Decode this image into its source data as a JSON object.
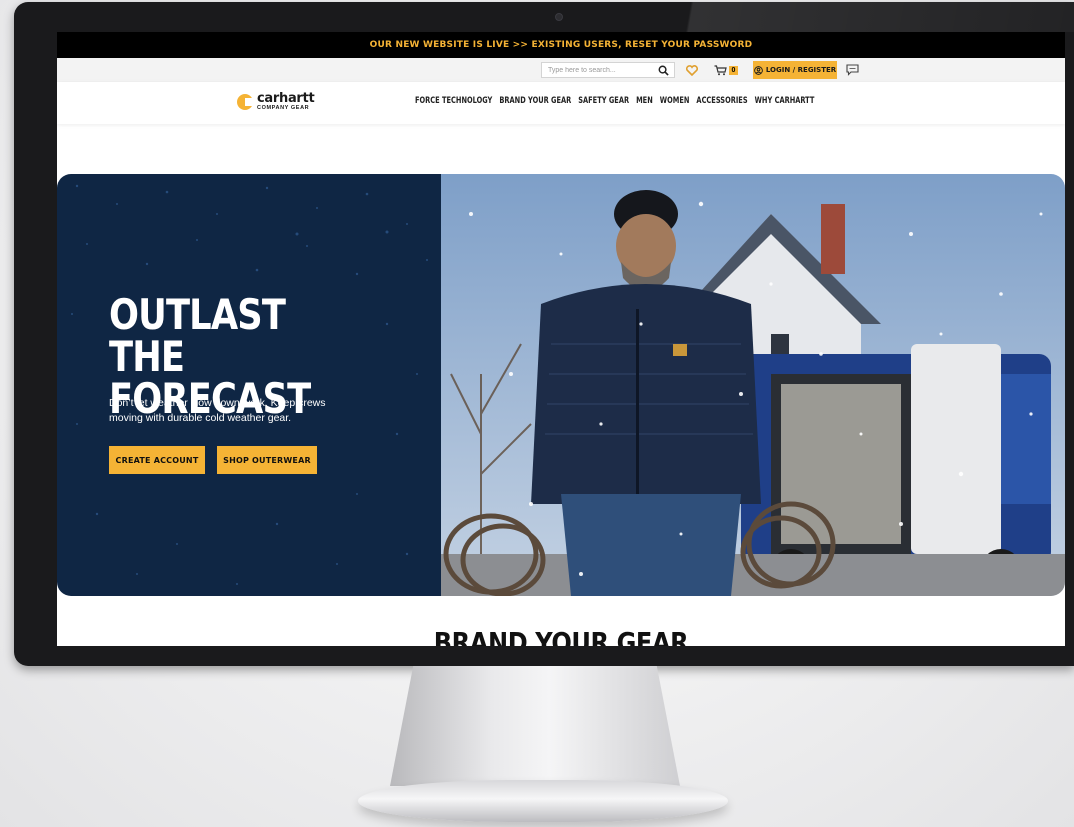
{
  "announcement": {
    "text": "OUR NEW WEBSITE IS LIVE >> EXISTING USERS, RESET YOUR PASSWORD"
  },
  "utility": {
    "search_placeholder": "Type here to search...",
    "cart_count": "0",
    "login_label": "LOGIN / REGISTER"
  },
  "logo": {
    "word": "carhartt",
    "sub": "COMPANY GEAR"
  },
  "nav": {
    "items": [
      {
        "label": "FORCE TECHNOLOGY"
      },
      {
        "label": "BRAND YOUR GEAR"
      },
      {
        "label": "SAFETY GEAR"
      },
      {
        "label": "MEN"
      },
      {
        "label": "WOMEN"
      },
      {
        "label": "ACCESSORIES"
      },
      {
        "label": "WHY CARHARTT"
      }
    ]
  },
  "hero": {
    "title_line1": "OUTLAST THE",
    "title_line2": "FORECAST",
    "subtitle": "Don’t let weather slow down work. Keep crews moving with durable cold weather gear.",
    "primary_button": "CREATE ACCOUNT",
    "secondary_button": "SHOP OUTERWEAR"
  },
  "next_section": {
    "heading": "BRAND YOUR GEAR"
  },
  "icons": {
    "search": "search-icon",
    "wishlist": "heart-icon",
    "cart": "cart-icon",
    "user": "user-icon",
    "chat": "chat-icon"
  },
  "colors": {
    "accent": "#f5b335",
    "hero_navy": "#0f2644",
    "announcement_bg": "#000000",
    "announcement_text": "#f5b335"
  }
}
